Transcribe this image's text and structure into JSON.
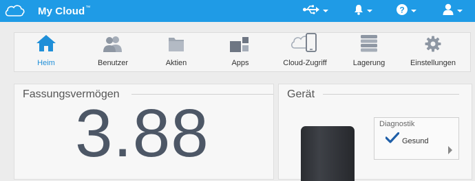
{
  "header": {
    "brand": "My Cloud",
    "brand_mark": "™",
    "icons": [
      "usb-icon",
      "bell-icon",
      "help-icon",
      "user-icon"
    ],
    "accent_color": "#1f9be6"
  },
  "nav": {
    "items": [
      {
        "label": "Heim",
        "icon": "home-icon",
        "active": true
      },
      {
        "label": "Benutzer",
        "icon": "users-icon"
      },
      {
        "label": "Aktien",
        "icon": "folder-icon"
      },
      {
        "label": "Apps",
        "icon": "apps-icon"
      },
      {
        "label": "Cloud-Zugriff",
        "icon": "cloud-access-icon"
      },
      {
        "label": "Lagerung",
        "icon": "storage-icon"
      },
      {
        "label": "Einstellungen",
        "icon": "gear-icon"
      }
    ],
    "active_color": "#1f8fd8"
  },
  "capacity": {
    "title": "Fassungsvermögen",
    "value": "3.88"
  },
  "device": {
    "title": "Gerät",
    "diagnostics": {
      "title": "Diagnostik",
      "status": "Gesund",
      "status_icon": "checkmark-icon"
    }
  }
}
